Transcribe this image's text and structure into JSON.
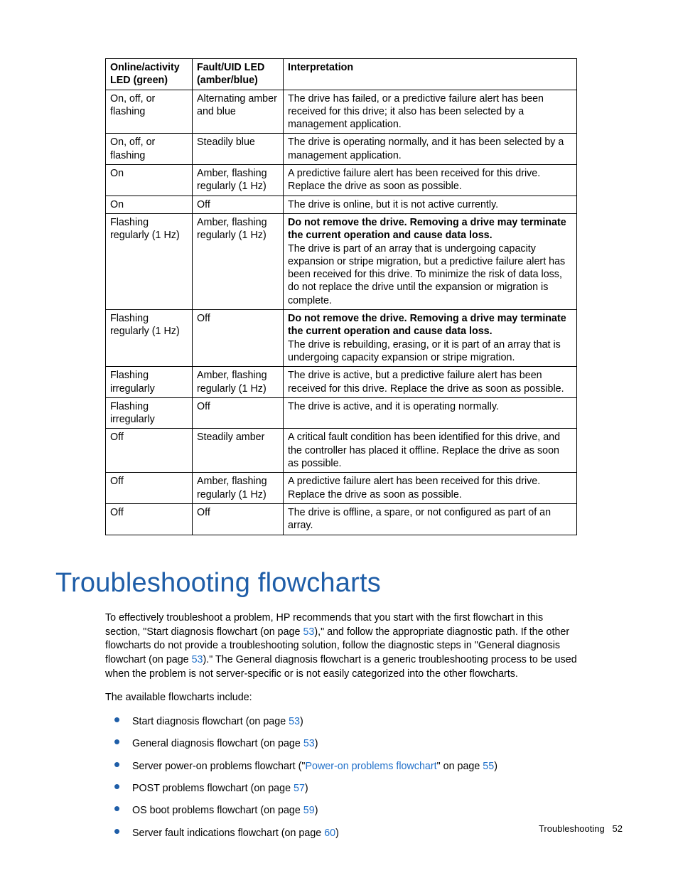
{
  "table": {
    "headers": {
      "col1": "Online/activity LED (green)",
      "col2": "Fault/UID LED (amber/blue)",
      "col3": "Interpretation"
    },
    "rows": [
      {
        "c1": "On, off, or flashing",
        "c2": "Alternating amber and blue",
        "c3_plain": "The drive has failed, or a predictive failure alert has been received for this drive; it also has been selected by a management application."
      },
      {
        "c1": "On, off, or flashing",
        "c2": "Steadily blue",
        "c3_plain": "The drive is operating normally, and it has been selected by a management application."
      },
      {
        "c1": "On",
        "c2": "Amber, flashing regularly (1 Hz)",
        "c3_plain": "A predictive failure alert has been received for this drive. Replace the drive as soon as possible."
      },
      {
        "c1": "On",
        "c2": "Off",
        "c3_plain": "The drive is online, but it is not active currently."
      },
      {
        "c1": "Flashing regularly (1 Hz)",
        "c2": "Amber, flashing regularly (1 Hz)",
        "c3_bold": "Do not remove the drive. Removing a drive may terminate the current operation and cause data loss.",
        "c3_rest": "The drive is part of an array that is undergoing capacity expansion or stripe migration, but a predictive failure alert has been received for this drive. To minimize the risk of data loss, do not replace the drive until the expansion or migration is complete."
      },
      {
        "c1": "Flashing regularly (1 Hz)",
        "c2": "Off",
        "c3_bold": "Do not remove the drive. Removing a drive may terminate the current operation and cause data loss.",
        "c3_rest": "The drive is rebuilding, erasing, or it is part of an array that is undergoing capacity expansion or stripe migration."
      },
      {
        "c1": "Flashing irregularly",
        "c2": "Amber, flashing regularly (1 Hz)",
        "c3_plain": "The drive is active, but a predictive failure alert has been received for this drive. Replace the drive as soon as possible."
      },
      {
        "c1": "Flashing irregularly",
        "c2": "Off",
        "c3_plain": "The drive is active, and it is operating normally."
      },
      {
        "c1": "Off",
        "c2": "Steadily amber",
        "c3_plain": "A critical fault condition has been identified for this drive, and the controller has placed it offline. Replace the drive as soon as possible."
      },
      {
        "c1": "Off",
        "c2": "Amber, flashing regularly (1 Hz)",
        "c3_plain": "A predictive failure alert has been received for this drive. Replace the drive as soon as possible."
      },
      {
        "c1": "Off",
        "c2": "Off",
        "c3_plain": "The drive is offline, a spare, or not configured as part of an array."
      }
    ]
  },
  "heading": "Troubleshooting flowcharts",
  "intro": {
    "p1a": "To effectively troubleshoot a problem, HP recommends that you start with the first flowchart in this section, \"Start diagnosis flowchart (on page ",
    "p1_link1": "53",
    "p1b": "),\" and follow the appropriate diagnostic path. If the other flowcharts do not provide a troubleshooting solution, follow the diagnostic steps in \"General diagnosis flowchart (on page ",
    "p1_link2": "53",
    "p1c": ").\" The General diagnosis flowchart is a generic troubleshooting process to be used when the problem is not server-specific or is not easily categorized into the other flowcharts.",
    "p2": "The available flowcharts include:"
  },
  "list": {
    "i1a": "Start diagnosis flowchart (on page ",
    "i1_link": "53",
    "i1b": ")",
    "i2a": "General diagnosis flowchart (on page ",
    "i2_link": "53",
    "i2b": ")",
    "i3a": "Server power-on problems flowchart (\"",
    "i3_linktext": "Power-on problems flowchart",
    "i3b": "\" on page ",
    "i3_link": "55",
    "i3c": ")",
    "i4a": "POST problems flowchart (on page ",
    "i4_link": "57",
    "i4b": ")",
    "i5a": "OS boot problems flowchart (on page ",
    "i5_link": "59",
    "i5b": ")",
    "i6a": "Server fault indications flowchart (on page ",
    "i6_link": "60",
    "i6b": ")"
  },
  "footer": {
    "label": "Troubleshooting",
    "page": "52"
  }
}
